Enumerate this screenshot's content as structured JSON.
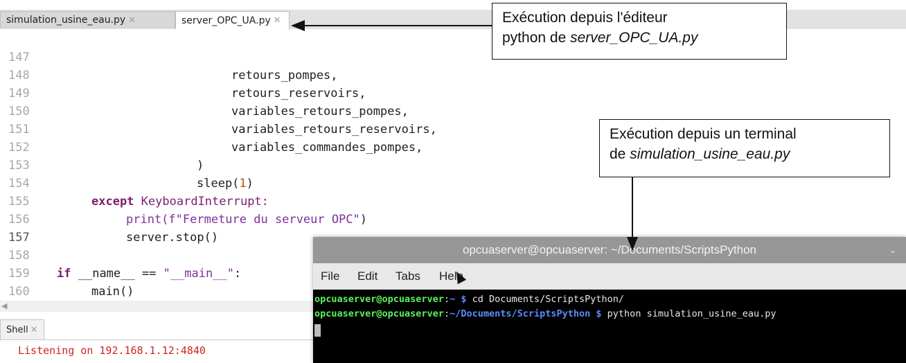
{
  "editor": {
    "tabs": [
      {
        "label": "simulation_usine_eau.py",
        "close": "✕"
      },
      {
        "label": "server_OPC_UA.py",
        "close": "✕"
      }
    ],
    "lines": [
      {
        "num": "147",
        "text": "retours_pompes,"
      },
      {
        "num": "148",
        "text": "retours_reservoirs,"
      },
      {
        "num": "149",
        "text": "variables_retours_pompes,"
      },
      {
        "num": "150",
        "text": "variables_retours_reservoirs,"
      },
      {
        "num": "151",
        "text": "variables_commandes_pompes,"
      },
      {
        "num": "152",
        "text": ")"
      },
      {
        "num": "153",
        "text": "sleep(",
        "num_arg": "1",
        "text_end": ")"
      },
      {
        "num": "154",
        "kw": "except",
        "text": "KeyboardInterrupt:"
      },
      {
        "num": "155",
        "func": "print(",
        "str": "f\"Fermeture du serveur OPC\"",
        "text_end": ")"
      },
      {
        "num": "156",
        "text": "server.stop()"
      },
      {
        "num": "157",
        "text": ""
      },
      {
        "num": "158",
        "kw": "if",
        "text": "__name__ ==",
        "str": "\"__main__\"",
        "text_end": ":"
      },
      {
        "num": "159",
        "text": "main()"
      },
      {
        "num": "160",
        "text": ""
      }
    ]
  },
  "shell": {
    "tab_label": "Shell",
    "tab_close": "✕",
    "output": "Listening on 192.168.1.12:4840"
  },
  "terminal": {
    "title": "opcuaserver@opcuaserver: ~/Documents/ScriptsPython",
    "chevron": "⌄",
    "menu": [
      "File",
      "Edit",
      "Tabs",
      "Help"
    ],
    "lines": [
      {
        "user": "opcuaserver@opcuaserver",
        "sep": ":",
        "path": "~",
        "prompt": " $",
        "cmd": " cd Documents/ScriptsPython/"
      },
      {
        "user": "opcuaserver@opcuaserver",
        "sep": ":",
        "path": "~/Documents/ScriptsPython",
        "prompt": " $",
        "cmd": " python simulation_usine_eau.py"
      }
    ]
  },
  "callouts": {
    "editor_line1": "Exécution depuis l'éditeur",
    "editor_line2_prefix": "python de ",
    "editor_line2_file": "server_OPC_UA.py",
    "terminal_line1": "Exécution depuis un terminal",
    "terminal_line2_prefix": "de ",
    "terminal_line2_file": "simulation_usine_eau.py"
  }
}
